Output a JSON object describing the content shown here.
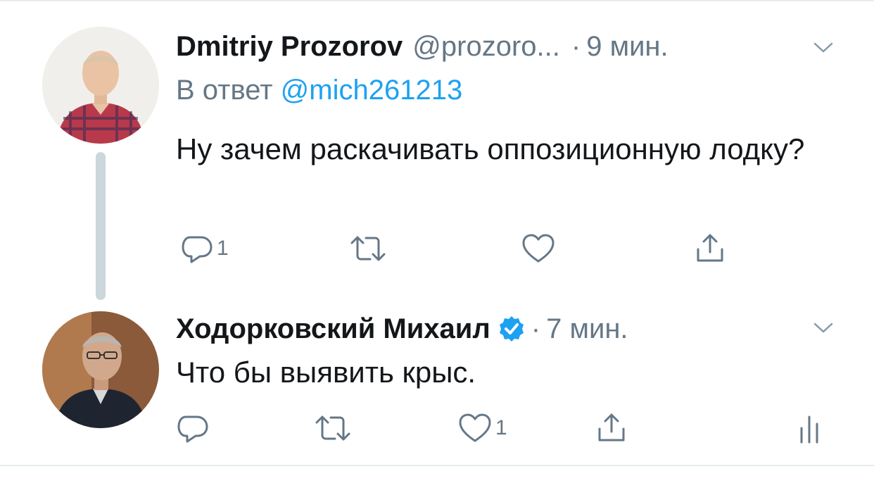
{
  "tweets": [
    {
      "author": "Dmitriy Prozorov",
      "handle": "@prozoro...",
      "dot": "·",
      "time": "9 мин.",
      "reply_prefix": "В ответ",
      "reply_to": "@mich261213",
      "text": "Ну зачем раскачивать оппозиционную лодку?",
      "actions": {
        "reply_count": "1",
        "retweet_count": "",
        "like_count": ""
      },
      "icons": [
        "reply-icon",
        "retweet-icon",
        "like-icon",
        "share-icon",
        "chevron-down-icon"
      ]
    },
    {
      "author": "Ходорковский Михаил",
      "verified": true,
      "dot": "·",
      "time": "7 мин.",
      "text": "Что бы выявить крыс.",
      "actions": {
        "reply_count": "",
        "retweet_count": "",
        "like_count": "1"
      },
      "icons": [
        "reply-icon",
        "retweet-icon",
        "like-icon",
        "share-icon",
        "analytics-icon",
        "chevron-down-icon"
      ]
    }
  ],
  "colors": {
    "name": "#14171a",
    "secondary": "#657786",
    "link": "#1da1f2",
    "thread_line": "#ccd6dd",
    "verified": "#1da1f2"
  }
}
